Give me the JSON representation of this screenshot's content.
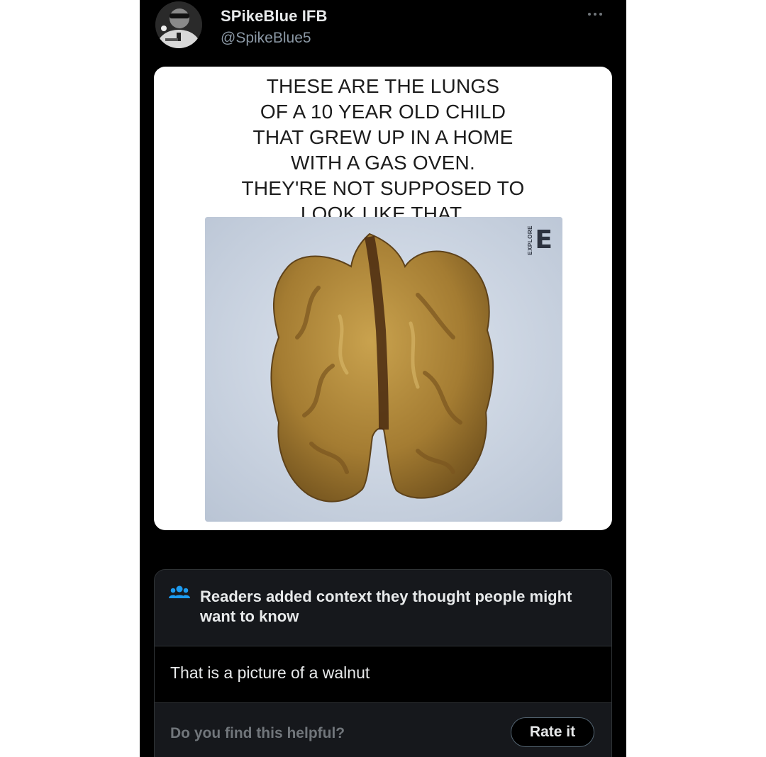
{
  "post": {
    "display_name": "SPikeBlue IFB",
    "handle": "@SpikeBlue5",
    "more_icon": "ellipsis-icon",
    "media": {
      "caption": "THESE ARE THE LUNGS\nOF A 10 YEAR OLD CHILD\nTHAT GREW UP IN A HOME\nWITH A GAS OVEN.\nTHEY'RE NOT SUPPOSED TO\nLOOK LIKE THAT.",
      "watermark_big": "E",
      "watermark_small": "EXPLORE"
    }
  },
  "community_note": {
    "icon": "people-icon",
    "title": "Readers added context they thought people might want to know",
    "body": "That is a picture of a walnut",
    "helpful_prompt": "Do you find this helpful?",
    "rate_button": "Rate it"
  },
  "colors": {
    "background": "#000000",
    "text_primary": "#e7e9ea",
    "text_secondary": "#71767b",
    "note_panel": "#16181c",
    "border": "#2f3336",
    "icon_blue": "#1d9bf0"
  }
}
